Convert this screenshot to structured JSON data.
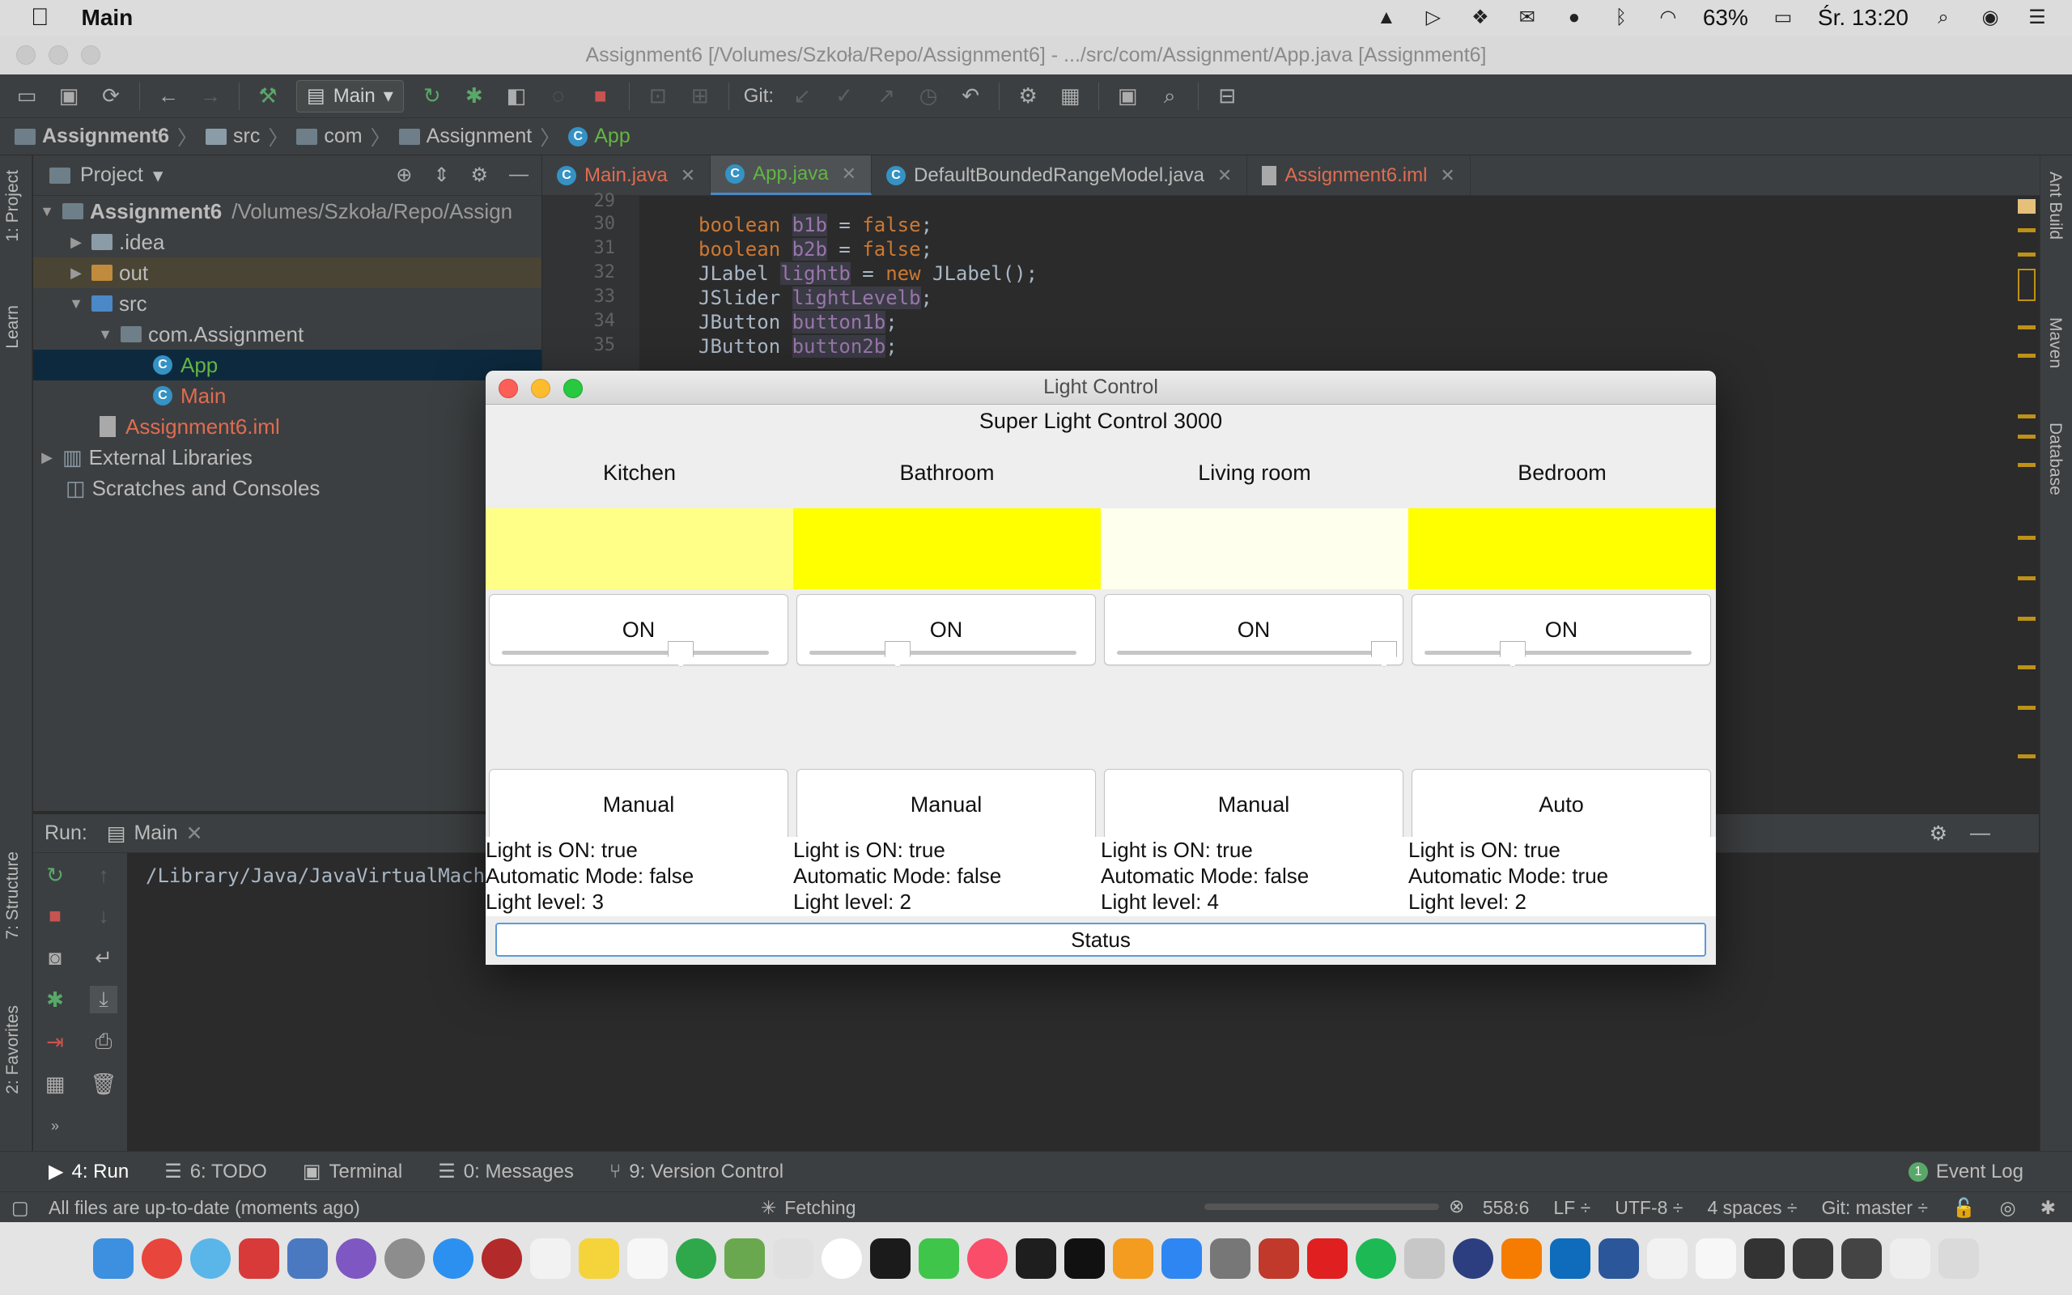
{
  "menubar": {
    "app_name": "Main",
    "battery": "63%",
    "clock": "Śr. 13:20"
  },
  "window": {
    "title": "Assignment6 [/Volumes/Szkoła/Repo/Assignment6] - .../src/com/Assignment/App.java [Assignment6]"
  },
  "toolbar": {
    "run_config": "Main",
    "git_label": "Git:"
  },
  "breadcrumb": [
    "Assignment6",
    "src",
    "com",
    "Assignment",
    "App"
  ],
  "project": {
    "header": "Project",
    "root_name": "Assignment6",
    "root_path": "/Volumes/Szkoła/Repo/Assign",
    "items": {
      "idea": ".idea",
      "out": "out",
      "src": "src",
      "pkg": "com.Assignment",
      "app": "App",
      "main": "Main",
      "iml": "Assignment6.iml",
      "libs": "External Libraries",
      "scratches": "Scratches and Consoles"
    }
  },
  "editor": {
    "tabs": [
      {
        "label": "Main.java"
      },
      {
        "label": "App.java"
      },
      {
        "label": "DefaultBoundedRangeModel.java"
      },
      {
        "label": "Assignment6.iml"
      }
    ],
    "line_numbers": [
      "29",
      "30",
      "31",
      "32",
      "33",
      "34",
      "35"
    ],
    "code": {
      "l30_type": "boolean",
      "l30_name": "b1b",
      "l30_rest": " = ",
      "l30_val": "false",
      "l31_type": "boolean",
      "l31_name": "b2b",
      "l31_val": "false",
      "l32_type": "JLabel ",
      "l32_name": "lightb",
      "l32_new": "new",
      "l32_rest": " JLabel();",
      "l33_type": "JSlider ",
      "l33_name": "lightLevelb",
      "l34_type": "JButton ",
      "l34_name": "button1b",
      "l35_type": "JButton ",
      "l35_name": "button2b"
    }
  },
  "side_tabs": {
    "project": "1: Project",
    "learn": "Learn",
    "structure": "7: Structure",
    "favorites": "2: Favorites",
    "ant": "Ant Build",
    "maven": "Maven",
    "database": "Database"
  },
  "run_panel": {
    "label": "Run:",
    "tab": "Main",
    "console_text": "/Library/Java/JavaVirtualMachi"
  },
  "bottom_bar": {
    "run": "4: Run",
    "todo": "6: TODO",
    "terminal": "Terminal",
    "messages": "0: Messages",
    "vcs": "9: Version Control",
    "event_log": "Event Log",
    "event_count": "1"
  },
  "status_bar": {
    "message": "All files are up-to-date (moments ago)",
    "fetching": "Fetching",
    "position": "558:6",
    "line_sep": "LF ÷",
    "encoding": "UTF-8 ÷",
    "indent": "4 spaces ÷",
    "branch": "Git: master ÷"
  },
  "light_control": {
    "window_title": "Light Control",
    "heading": "Super Light Control 3000",
    "status_label": "Status",
    "rooms": [
      {
        "name": "Kitchen",
        "color": "#ffff88",
        "on_label": "ON",
        "mode_label": "Manual",
        "slider_fraction": 0.67,
        "info_on": "Light is ON: true",
        "info_auto": "Automatic Mode: false",
        "info_level": "Light level: 3"
      },
      {
        "name": "Bathroom",
        "color": "#ffff00",
        "on_label": "ON",
        "mode_label": "Manual",
        "slider_fraction": 0.33,
        "info_on": "Light is ON: true",
        "info_auto": "Automatic Mode: false",
        "info_level": "Light level: 2"
      },
      {
        "name": "Living room",
        "color": "#ffffee",
        "on_label": "ON",
        "mode_label": "Manual",
        "slider_fraction": 1.0,
        "info_on": "Light is ON: true",
        "info_auto": "Automatic Mode: false",
        "info_level": "Light level: 4"
      },
      {
        "name": "Bedroom",
        "color": "#ffff00",
        "on_label": "ON",
        "mode_label": "Auto",
        "slider_fraction": 0.33,
        "info_on": "Light is ON: true",
        "info_auto": "Automatic Mode: true",
        "info_level": "Light level: 2"
      }
    ]
  }
}
